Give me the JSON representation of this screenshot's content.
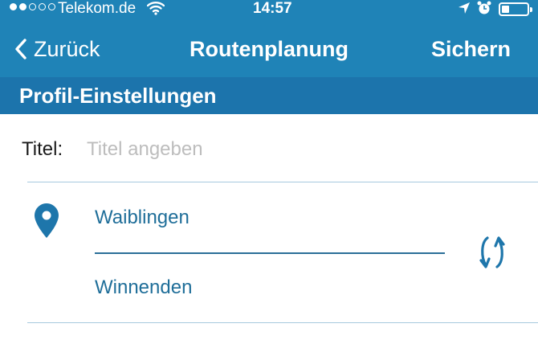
{
  "status_bar": {
    "carrier": "Telekom.de",
    "time": "14:57",
    "signal_filled": 2,
    "signal_total": 5,
    "battery_level": 0.3,
    "icons": [
      "wifi-icon",
      "location-arrow-icon",
      "alarm-clock-icon",
      "battery-icon"
    ]
  },
  "nav": {
    "back_label": "Zurück",
    "title": "Routenplanung",
    "save_label": "Sichern"
  },
  "section": {
    "title": "Profil-Einstellungen"
  },
  "form": {
    "title_label": "Titel:",
    "title_value": "",
    "title_placeholder": "Titel angeben"
  },
  "route": {
    "start": "Waiblingen",
    "destination": "Winnenden",
    "icons": [
      "location-pin-icon",
      "swap-icon"
    ]
  },
  "colors": {
    "nav_background": "#1f83b7",
    "section_background": "#1c74ac",
    "accent_text": "#1f6e99",
    "divider": "#a6c9de"
  }
}
